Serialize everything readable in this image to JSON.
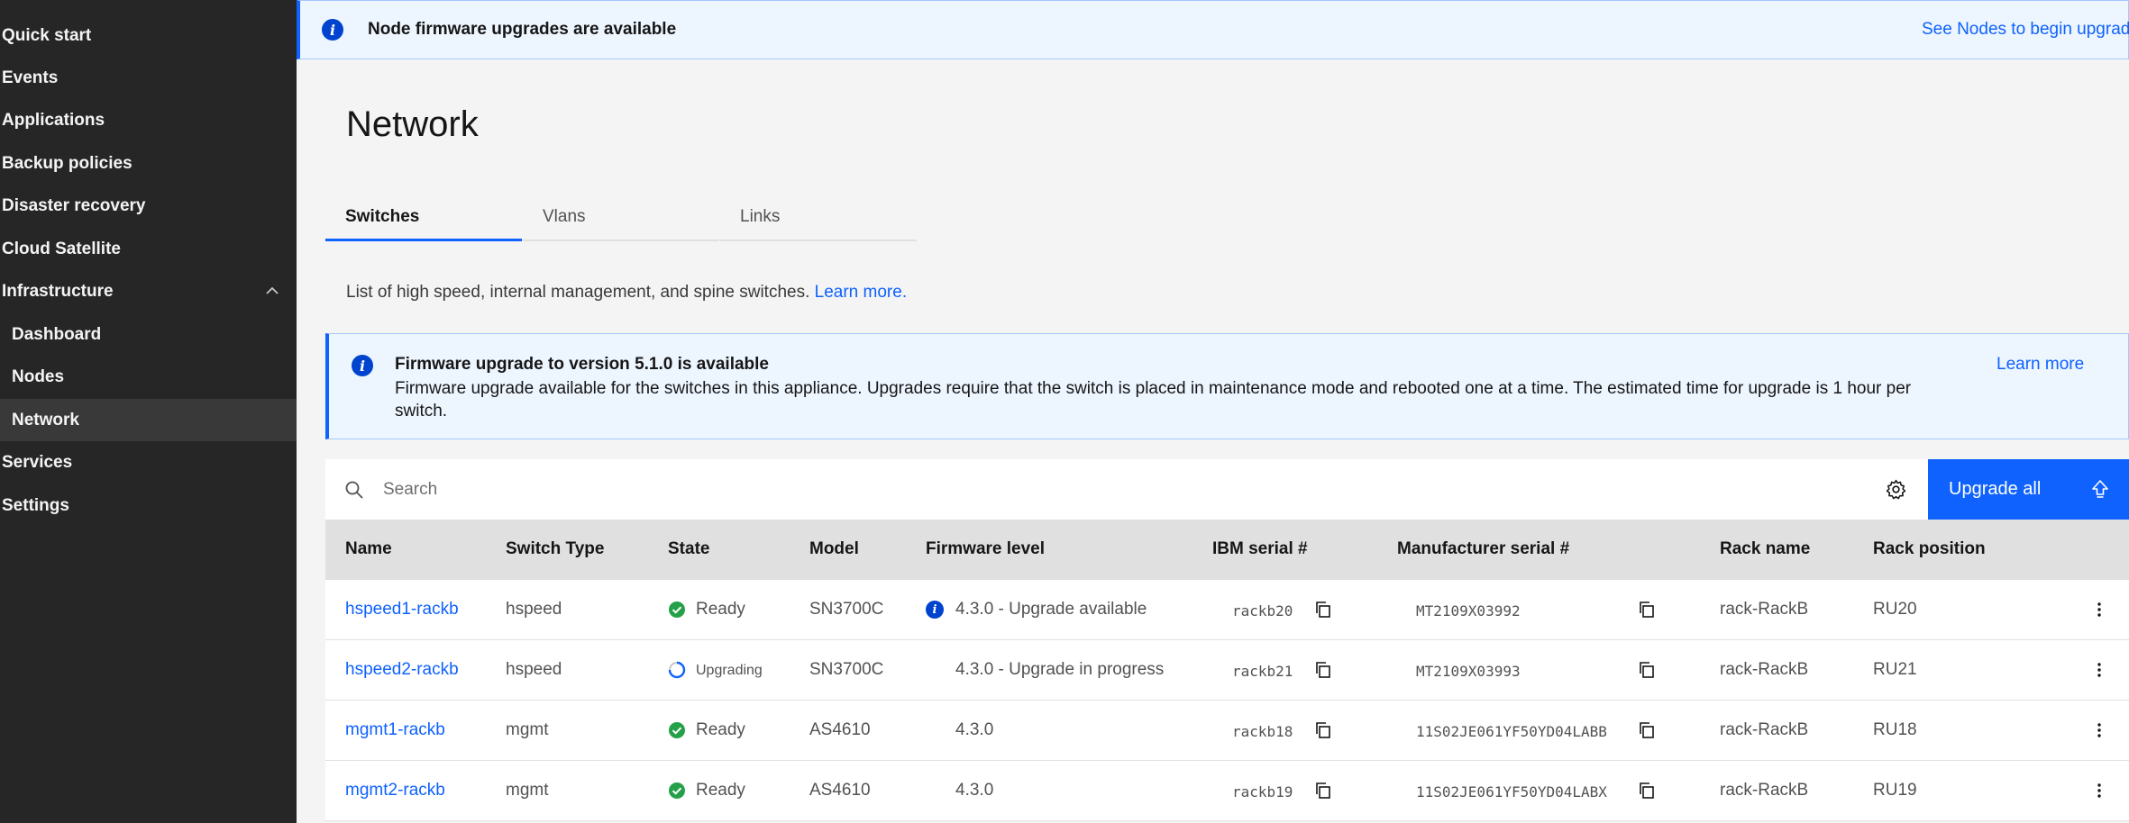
{
  "sidebar": {
    "items": [
      {
        "label": "Quick start"
      },
      {
        "label": "Events"
      },
      {
        "label": "Applications"
      },
      {
        "label": "Backup policies"
      },
      {
        "label": "Disaster recovery"
      },
      {
        "label": "Cloud Satellite"
      },
      {
        "label": "Infrastructure"
      },
      {
        "label": "Dashboard"
      },
      {
        "label": "Nodes"
      },
      {
        "label": "Network"
      },
      {
        "label": "Services"
      },
      {
        "label": "Settings"
      }
    ]
  },
  "top_banner": {
    "title": "Node firmware upgrades are available",
    "link": "See Nodes to begin upgrad"
  },
  "page": {
    "title": "Network",
    "tabs": [
      {
        "label": "Switches"
      },
      {
        "label": "Vlans"
      },
      {
        "label": "Links"
      }
    ],
    "description": "List of high speed, internal management, and spine switches.",
    "description_link": "Learn more."
  },
  "fw_banner": {
    "title": "Firmware upgrade to version 5.1.0 is available",
    "body": "Firmware upgrade available for the switches in this appliance. Upgrades require that the switch is placed in maintenance mode and rebooted one at a time. The estimated time for upgrade is 1 hour per switch.",
    "link": "Learn more"
  },
  "toolbar": {
    "search_placeholder": "Search",
    "upgrade_label": "Upgrade all"
  },
  "table": {
    "headers": {
      "name": "Name",
      "switch_type": "Switch Type",
      "state": "State",
      "model": "Model",
      "firmware": "Firmware level",
      "ibm_serial": "IBM serial #",
      "mfr_serial": "Manufacturer serial #",
      "rack_name": "Rack name",
      "rack_position": "Rack position"
    },
    "rows": [
      {
        "name": "hspeed1-rackb",
        "type": "hspeed",
        "state": "Ready",
        "model": "SN3700C",
        "firmware": "4.3.0 - Upgrade available",
        "ibm_serial": "rackb20",
        "mfr_serial": "MT2109X03992",
        "rack_name": "rack-RackB",
        "rack_position": "RU20"
      },
      {
        "name": "hspeed2-rackb",
        "type": "hspeed",
        "state": "Upgrading",
        "model": "SN3700C",
        "firmware": "4.3.0 - Upgrade in progress",
        "ibm_serial": "rackb21",
        "mfr_serial": "MT2109X03993",
        "rack_name": "rack-RackB",
        "rack_position": "RU21"
      },
      {
        "name": "mgmt1-rackb",
        "type": "mgmt",
        "state": "Ready",
        "model": "AS4610",
        "firmware": "4.3.0",
        "ibm_serial": "rackb18",
        "mfr_serial": "11S02JE061YF50YD04LABB",
        "rack_name": "rack-RackB",
        "rack_position": "RU18"
      },
      {
        "name": "mgmt2-rackb",
        "type": "mgmt",
        "state": "Ready",
        "model": "AS4610",
        "firmware": "4.3.0",
        "ibm_serial": "rackb19",
        "mfr_serial": "11S02JE061YF50YD04LABX",
        "rack_name": "rack-RackB",
        "rack_position": "RU19"
      }
    ]
  },
  "colors": {
    "accent": "#0f62fe",
    "sidebar_bg": "#262626",
    "ready": "#24a148"
  }
}
